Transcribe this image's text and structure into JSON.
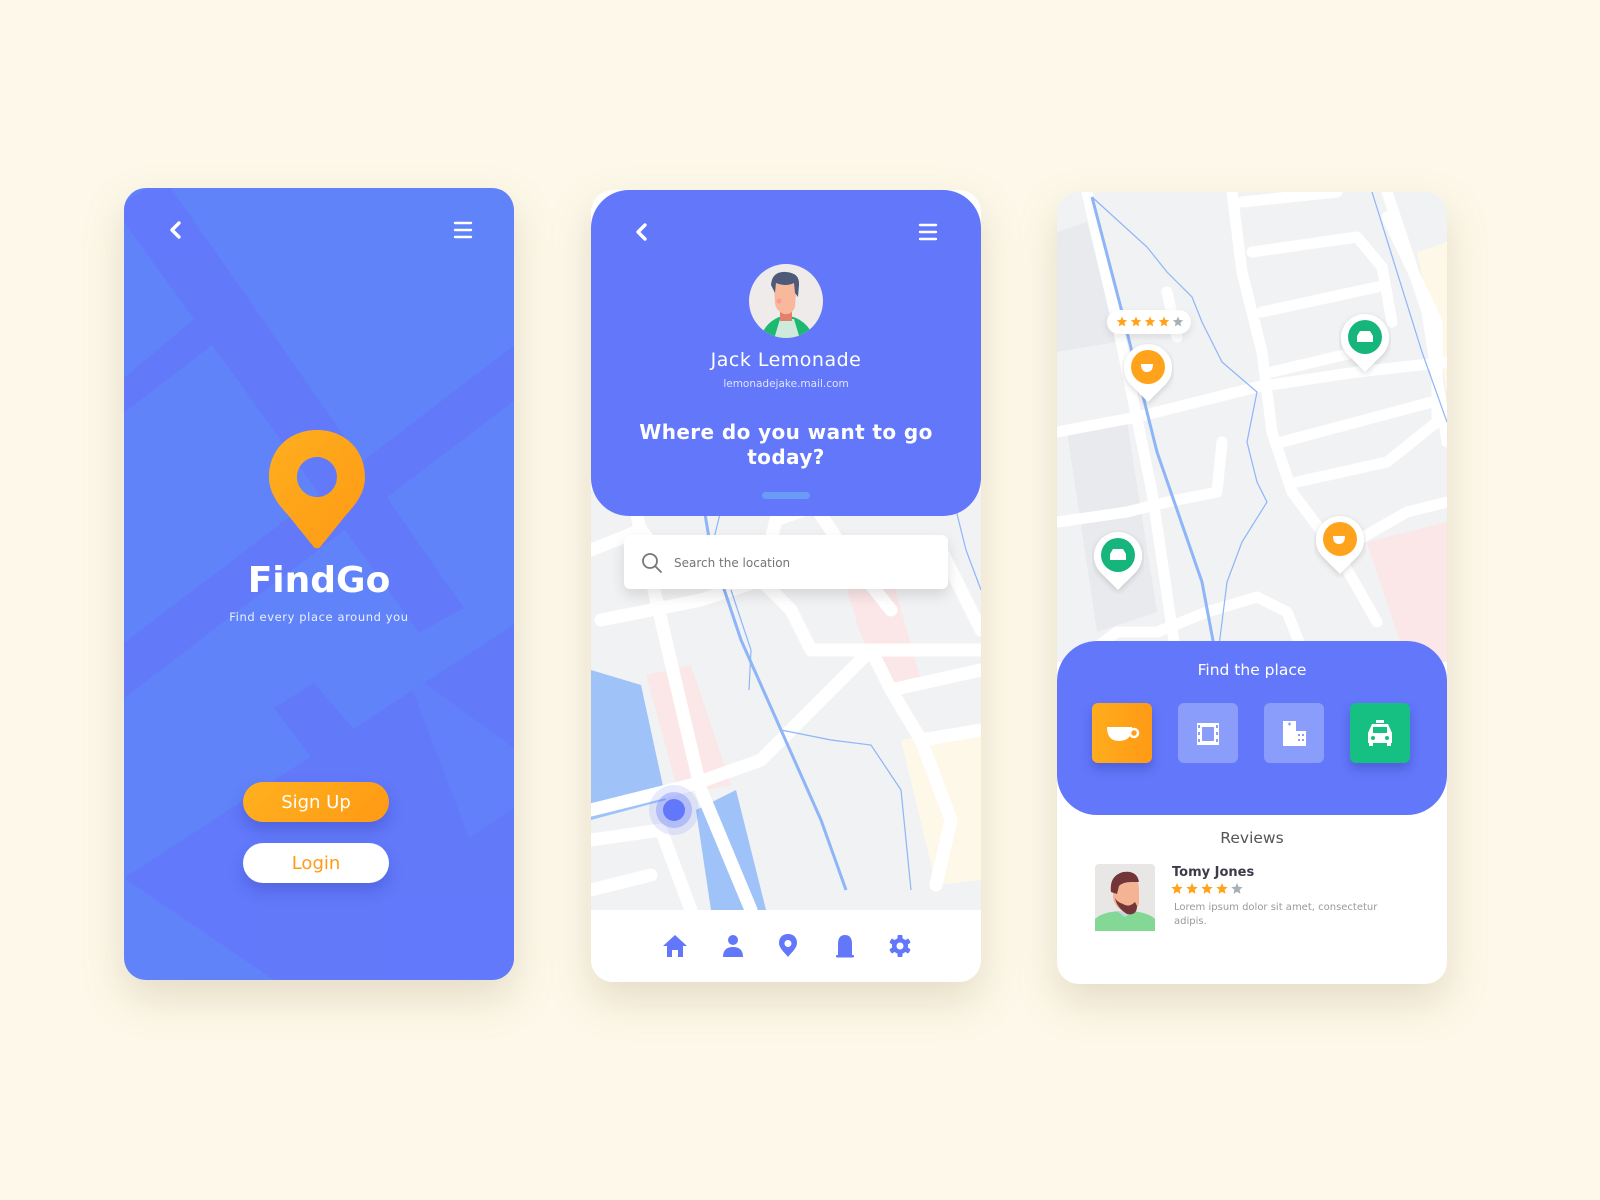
{
  "colors": {
    "background": "#fdf8e9",
    "primary_blue": "#6377fb",
    "splash_blue": "#6183f9",
    "accent_orange": "#ffa21c",
    "accent_green": "#16c083",
    "map_land": "#f1f2f4",
    "map_water": "#9fc2f8",
    "map_pink": "#fbe7e8",
    "map_yellow": "#fef8e8"
  },
  "splash": {
    "back_icon": "chevron-left-icon",
    "menu_icon": "hamburger-menu-icon",
    "logo_icon": "location-pin-icon",
    "app_name": "FindGo",
    "tagline": "Find every place around you",
    "signup_label": "Sign Up",
    "login_label": "Login"
  },
  "profile": {
    "back_icon": "chevron-left-icon",
    "menu_icon": "hamburger-menu-icon",
    "user_name": "Jack Lemonade",
    "user_email": "lemonadejake.mail.com",
    "prompt": "Where do you want to go today?",
    "search_placeholder": "Search the location",
    "nav": [
      {
        "name": "home",
        "icon": "home-icon"
      },
      {
        "name": "profile",
        "icon": "user-icon"
      },
      {
        "name": "location",
        "icon": "location-pin-icon"
      },
      {
        "name": "notifications",
        "icon": "bell-icon"
      },
      {
        "name": "settings",
        "icon": "gear-icon"
      }
    ]
  },
  "explore": {
    "map_pins": [
      {
        "type": "cafe",
        "icon": "coffee-cup-icon",
        "rating": 4,
        "rating_max": 5
      },
      {
        "type": "taxi",
        "icon": "taxi-icon"
      },
      {
        "type": "taxi",
        "icon": "taxi-icon"
      },
      {
        "type": "cafe",
        "icon": "coffee-cup-icon"
      }
    ],
    "find_title": "Find the place",
    "categories": [
      {
        "name": "cafe",
        "icon": "coffee-cup-icon",
        "active": true
      },
      {
        "name": "cinema",
        "icon": "film-icon",
        "active": false
      },
      {
        "name": "hospital",
        "icon": "hospital-icon",
        "active": false
      },
      {
        "name": "taxi",
        "icon": "taxi-icon",
        "active": true
      }
    ],
    "reviews_title": "Reviews",
    "review": {
      "author": "Tomy Jones",
      "rating": 4,
      "rating_max": 5,
      "text": "Lorem ipsum dolor sit amet, consectetur adipis."
    }
  }
}
